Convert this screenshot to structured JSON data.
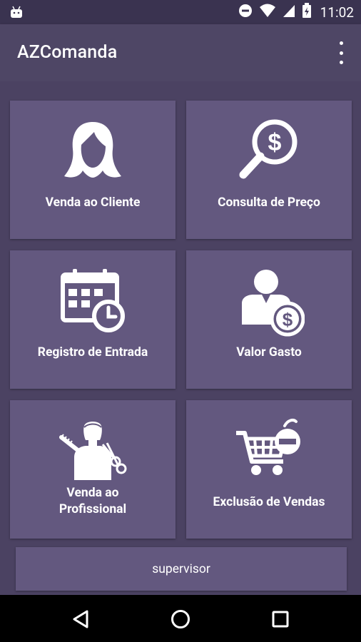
{
  "status_bar": {
    "time": "11:02",
    "icons": [
      "android-notification-icon",
      "do-not-disturb-icon",
      "wifi-icon",
      "cell-signal-icon",
      "battery-charging-icon"
    ]
  },
  "app_bar": {
    "title": "AZComanda",
    "menu_icon": "overflow-menu-icon"
  },
  "tiles": [
    {
      "label": "Venda ao Cliente",
      "icon": "woman-hair-icon"
    },
    {
      "label": "Consulta de Preço",
      "icon": "magnifier-dollar-icon"
    },
    {
      "label": "Registro de Entrada",
      "icon": "calendar-clock-icon"
    },
    {
      "label": "Valor Gasto",
      "icon": "person-dollar-icon"
    },
    {
      "label_line1": "Venda ao",
      "label_line2": "Profissional",
      "icon": "barber-icon"
    },
    {
      "label": "Exclusão de Vendas",
      "icon": "cart-remove-icon"
    }
  ],
  "supervisor_label": "supervisor",
  "nav_bar": {
    "back_icon": "back-icon",
    "home_icon": "home-icon",
    "recents_icon": "recents-icon"
  },
  "colors": {
    "background": "#4b4262",
    "tile": "#63587f",
    "status_bar": "#3a3350",
    "app_bar": "#4e4665"
  }
}
